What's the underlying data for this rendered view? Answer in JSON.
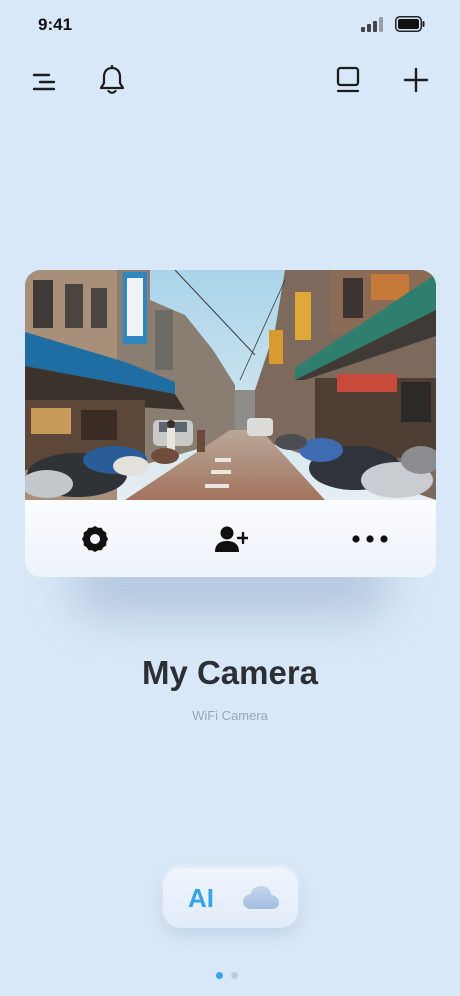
{
  "status_bar": {
    "time": "9:41"
  },
  "top_bar": {
    "icons": [
      "menu-icon",
      "bell-icon",
      "device-icon",
      "plus-icon"
    ]
  },
  "camera_card": {
    "actions": [
      "gear-icon",
      "add-user-icon",
      "more-icon"
    ]
  },
  "device": {
    "name": "My Camera",
    "type": "WiFi Camera"
  },
  "services": {
    "ai_label": "AI",
    "cloud_icon": "cloud-icon"
  },
  "pager": {
    "pages": 2,
    "active": 1
  },
  "colors": {
    "background": "#d9e8f8",
    "accent": "#35a4ec",
    "title": "#2c2f33",
    "subtitle": "#9aa6b4"
  }
}
